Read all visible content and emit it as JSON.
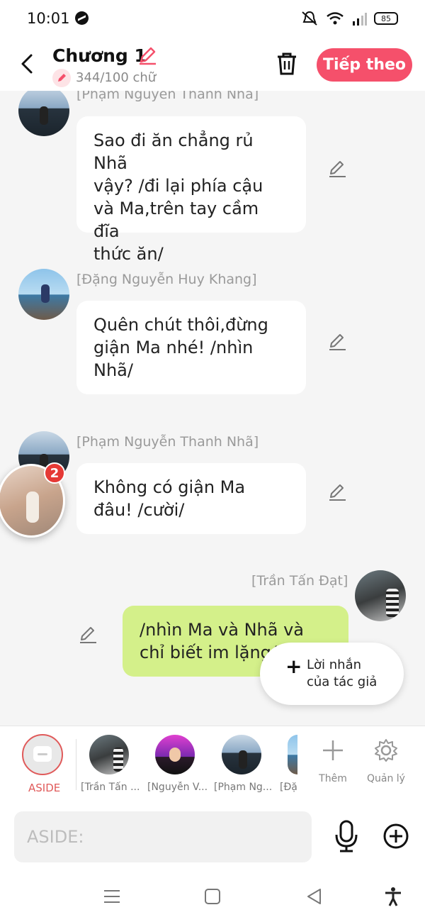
{
  "status": {
    "time": "10:01",
    "battery": "85"
  },
  "header": {
    "title": "Chương 1",
    "word_count": "344/100 chữ",
    "next_button": "Tiếp theo"
  },
  "messages": [
    {
      "sender": "[Phạm Nguyễn Thanh Nhã]",
      "lines": [
        "Sao đi ăn chẳng rủ Nhã",
        "vậy? /đi lại phía cậu",
        "và Ma,trên tay cầm đĩa",
        "thức ăn/"
      ]
    },
    {
      "sender": "[Đặng Nguyễn Huy Khang]",
      "lines": [
        "Quên chút thôi,đừng",
        "giận Ma nhé! /nhìn",
        "Nhã/"
      ]
    },
    {
      "sender": "[Phạm Nguyễn Thanh Nhã]",
      "lines": [
        "Không có giận Ma",
        "đâu! /cười/"
      ]
    },
    {
      "sender": "[Trần Tấn Đạt]",
      "lines": [
        "/nhìn Ma và Nhã và",
        "chỉ biết im lặng/"
      ]
    }
  ],
  "floating_badge": "2",
  "author_note": {
    "line1": "Lời nhắn",
    "line2": "của tác giả"
  },
  "characters": {
    "aside_label": "ASIDE",
    "list": [
      "[Trần Tấn ...",
      "[Nguyễn V...",
      "[Phạm Ng...",
      "[Đặng..."
    ],
    "add_label": "Thêm",
    "manage_label": "Quản lý"
  },
  "input": {
    "placeholder": "ASIDE:"
  },
  "colors": {
    "accent": "#f5506b",
    "my_bubble": "#d4f08a",
    "badge": "#e53935"
  }
}
